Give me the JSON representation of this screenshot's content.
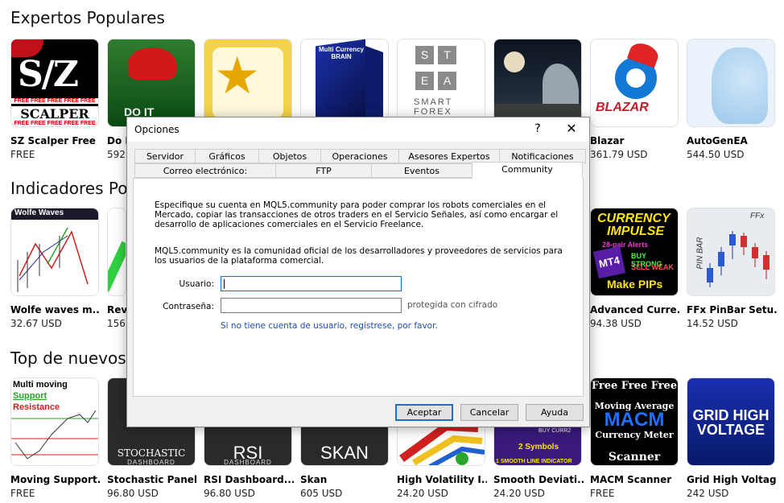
{
  "sections": {
    "experts": "Expertos Populares",
    "indicators": "Indicadores Pop",
    "top_new": "Top de nuevos p"
  },
  "products_row1": [
    {
      "name": "SZ Scalper Free",
      "price": "FREE"
    },
    {
      "name": "Do I",
      "price": "592."
    },
    {
      "name": "",
      "price": ""
    },
    {
      "name": "",
      "price": ""
    },
    {
      "name": "",
      "price": ""
    },
    {
      "name": "",
      "price": ""
    },
    {
      "name": "Blazar",
      "price": "361.79 USD"
    },
    {
      "name": "AutoGenEA",
      "price": "544.50 USD"
    }
  ],
  "products_row2": [
    {
      "name": "Wolfe waves m...",
      "price": "32.67 USD"
    },
    {
      "name": "Reve",
      "price": "156."
    },
    {
      "name": "Advanced Curre...",
      "price": "94.38 USD"
    },
    {
      "name": "FFx PinBar Setu...",
      "price": "14.52 USD"
    }
  ],
  "products_row3": [
    {
      "name": "Moving Support...",
      "price": "FREE"
    },
    {
      "name": "Stochastic Panel",
      "price": "96.80 USD"
    },
    {
      "name": "RSI Dashboard...",
      "price": "96.80 USD"
    },
    {
      "name": "Skan",
      "price": "605 USD"
    },
    {
      "name": "High Volatility I...",
      "price": "24.20 USD"
    },
    {
      "name": "Smooth Deviati...",
      "price": "24.20 USD"
    },
    {
      "name": "MACM Scanner",
      "price": "FREE"
    },
    {
      "name": "Grid High Voltage",
      "price": "242 USD"
    }
  ],
  "tile_text": {
    "sz_big": "S/Z",
    "sz_free": "FREE  FREE  FREE  FREE  FREE",
    "sz_scalper": "SCALPER",
    "do_it": "DO IT",
    "brain": "Multi Currency BRAIN",
    "stea": [
      "S",
      "T",
      "E",
      "A"
    ],
    "smart_forex": "SMART\nFOREX",
    "blazar": "BLAZAR",
    "wolfe": "Wolfe Waves",
    "currency1": "CURRENCY",
    "currency2": "IMPULSE",
    "currency3": "28-pair Alerts",
    "currency4": "MT4",
    "currency5": "BUY STRONG",
    "currency6": "SELL WEAK",
    "currency7": "Make PIPs",
    "ffx": "FFx",
    "pinbar": "PIN BAR",
    "multi1": "Multi moving",
    "multi2": "Support",
    "multi3": "Resistance",
    "stoch1": "STOCHASTIC",
    "stoch2": "DASHBOARD",
    "rsi1": "RSI",
    "rsi2": "DASHBOARD",
    "skan": "SKAN",
    "sd1": "2 Symbols",
    "sd2": "BUY CURR2",
    "sd3": "1 SMOOTH LINE INDICATOR",
    "macm1": "Free Free Free",
    "macm2": "Moving Average",
    "macm3": "MACM",
    "macm4": "Currency Meter",
    "macm5": "Scanner",
    "grid1": "GRID HIGH",
    "grid2": "VOLTAGE"
  },
  "dialog": {
    "title": "Opciones",
    "help": "?",
    "close": "✕",
    "tabs_row1": [
      "Servidor",
      "Gráficos",
      "Objetos",
      "Operaciones",
      "Asesores Expertos",
      "Notificaciones"
    ],
    "tabs_row2": [
      "Correo electrónico:",
      "FTP",
      "Eventos",
      "Community"
    ],
    "para1": "Especifique su cuenta en MQL5.community para poder comprar los robots comerciales en el Mercado, copiar las transacciones de otros traders en el Servicio Señales, así como encargar el desarrollo de aplicaciones comerciales en el Servicio Freelance.",
    "para2": "MQL5.community es la comunidad oficial de los desarrolladores y proveedores de servicios para los usuarios de la plataforma comercial.",
    "user_label": "Usuario:",
    "user_value": "",
    "password_label": "Contraseña:",
    "password_value": "",
    "password_hint": "protegida con cifrado",
    "register_link": "Si no tiene cuenta de usuario, regístrese, por favor.",
    "ok": "Aceptar",
    "cancel": "Cancelar",
    "help_btn": "Ayuda"
  }
}
